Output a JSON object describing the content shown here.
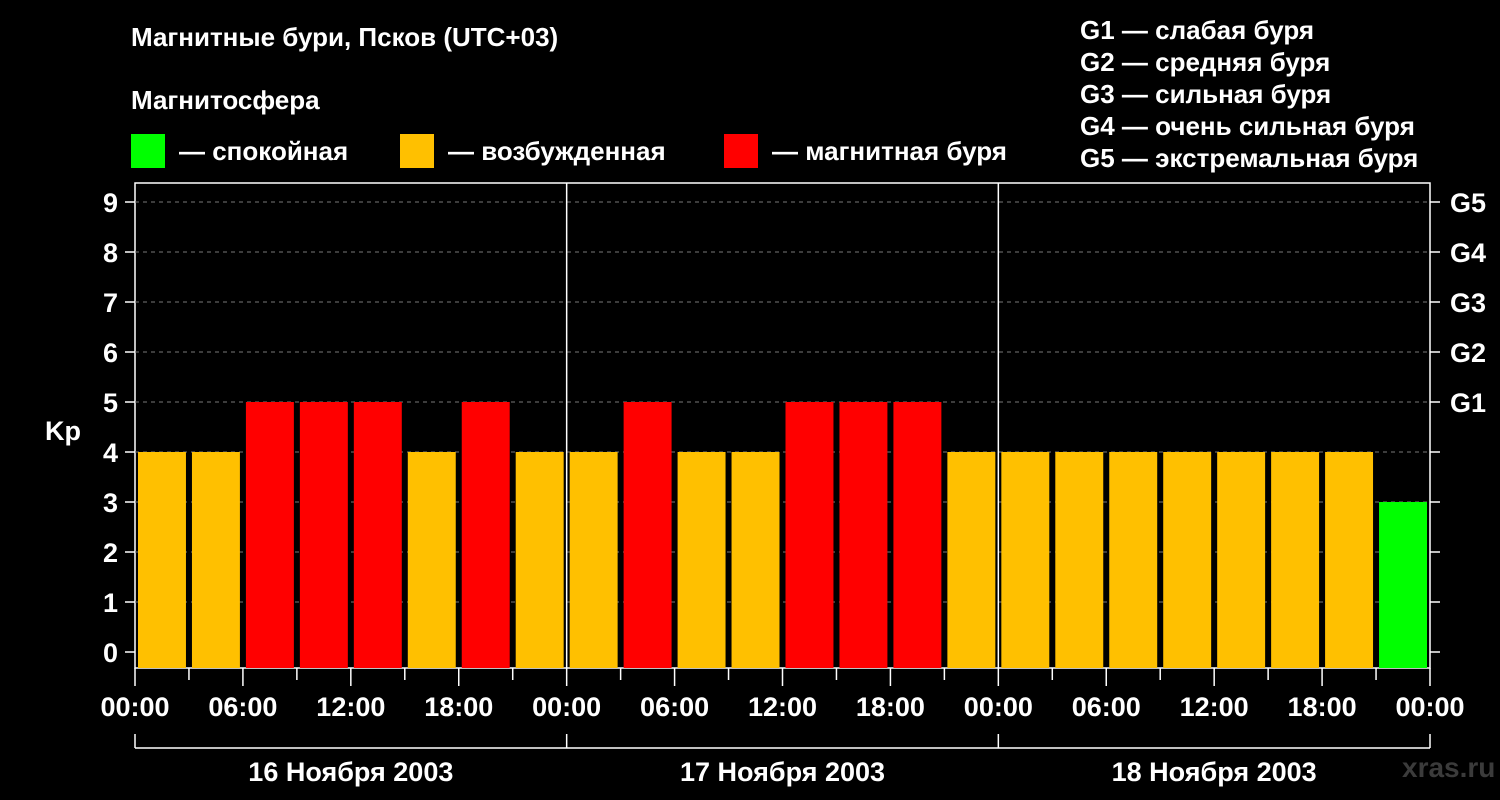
{
  "title": "Магнитные бури, Псков (UTC+03)",
  "legend": {
    "heading": "Магнитосфера",
    "items": [
      {
        "label": "— спокойная",
        "color": "#00ff00"
      },
      {
        "label": "— возбужденная",
        "color": "#ffc000"
      },
      {
        "label": "— магнитная буря",
        "color": "#ff0000"
      }
    ]
  },
  "g_scale": [
    "G1 — слабая буря",
    "G2 — средняя буря",
    "G3 — сильная буря",
    "G4 — очень сильная буря",
    "G5 — экстремальная буря"
  ],
  "credit": "xras.ru",
  "colors": {
    "quiet": "#00ff00",
    "active": "#ffc000",
    "storm": "#ff0000",
    "background": "#000000",
    "axes": "#ffffff"
  },
  "chart_data": {
    "type": "bar",
    "ylabel": "Kp",
    "ylim": [
      0,
      9
    ],
    "y_ticks": [
      "0",
      "1",
      "2",
      "3",
      "4",
      "5",
      "6",
      "7",
      "8",
      "9"
    ],
    "g_ticks": [
      {
        "kp": 5,
        "label": "G1"
      },
      {
        "kp": 6,
        "label": "G2"
      },
      {
        "kp": 7,
        "label": "G3"
      },
      {
        "kp": 8,
        "label": "G4"
      },
      {
        "kp": 9,
        "label": "G5"
      }
    ],
    "x_tick_labels": [
      "00:00",
      "06:00",
      "12:00",
      "18:00",
      "00:00",
      "06:00",
      "12:00",
      "18:00",
      "00:00",
      "06:00",
      "12:00",
      "18:00",
      "00:00"
    ],
    "days": [
      "16 Ноября 2003",
      "17 Ноября 2003",
      "18 Ноября 2003"
    ],
    "interval_hours": 3,
    "values": [
      4,
      4,
      5,
      5,
      5,
      4,
      5,
      4,
      4,
      5,
      4,
      4,
      5,
      5,
      5,
      4,
      4,
      4,
      4,
      4,
      4,
      4,
      4,
      3
    ],
    "grid": true,
    "legend_position": "top"
  }
}
